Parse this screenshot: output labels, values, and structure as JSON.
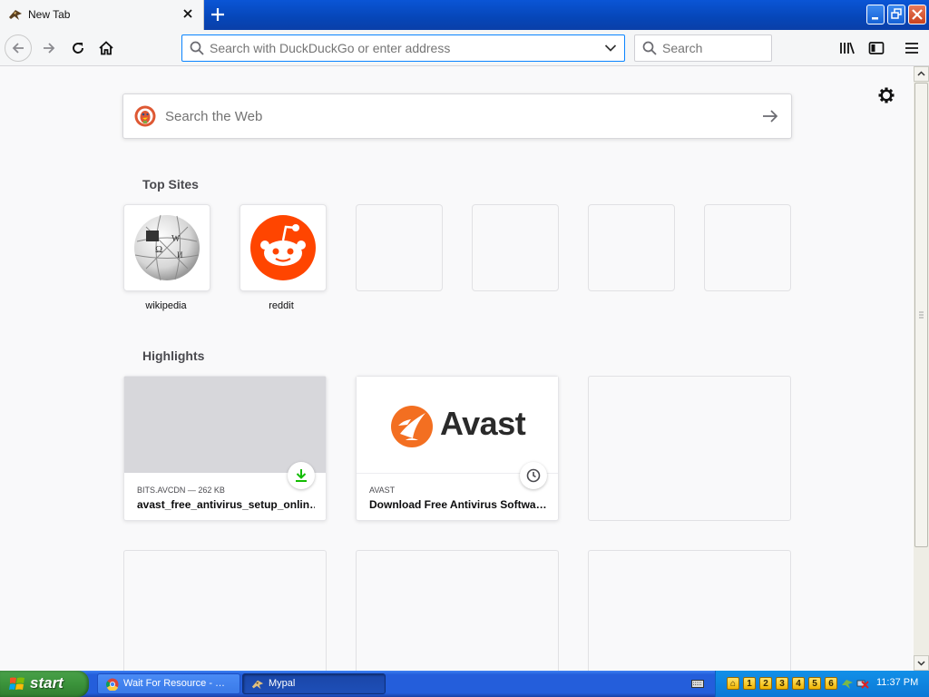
{
  "tab": {
    "title": "New Tab"
  },
  "urlbar": {
    "placeholder": "Search with DuckDuckGo or enter address"
  },
  "searchbar": {
    "placeholder": "Search"
  },
  "newtab": {
    "websearch_placeholder": "Search the Web",
    "topsites_title": "Top Sites",
    "topsites": [
      {
        "label": "wikipedia",
        "icon": "wikipedia-globe-icon"
      },
      {
        "label": "reddit",
        "icon": "reddit-icon"
      },
      {
        "label": ""
      },
      {
        "label": ""
      },
      {
        "label": ""
      },
      {
        "label": ""
      }
    ],
    "highlights_title": "Highlights",
    "highlights": [
      {
        "meta": "BITS.AVCDN — 262 KB",
        "title": "avast_free_antivirus_setup_onlin…",
        "badge": "download-icon"
      },
      {
        "meta": "AVAST",
        "title": "Download Free Antivirus Softwa…",
        "badge": "clock-icon",
        "logo_text": "Avast"
      }
    ]
  },
  "taskbar": {
    "start_label": "start",
    "tasks": [
      {
        "label": "Wait For Resource - …",
        "icon": "chrome-icon"
      },
      {
        "label": "Mypal",
        "icon": "mypal-icon"
      }
    ],
    "tray_numbers": [
      "1",
      "2",
      "3",
      "4",
      "5",
      "6"
    ],
    "clock": "11:37 PM"
  },
  "colors": {
    "accent": "#0a84ff",
    "taskbar": "#245edb",
    "start": "#3b933b",
    "avast": "#f36f21",
    "reddit": "#ff4500"
  }
}
